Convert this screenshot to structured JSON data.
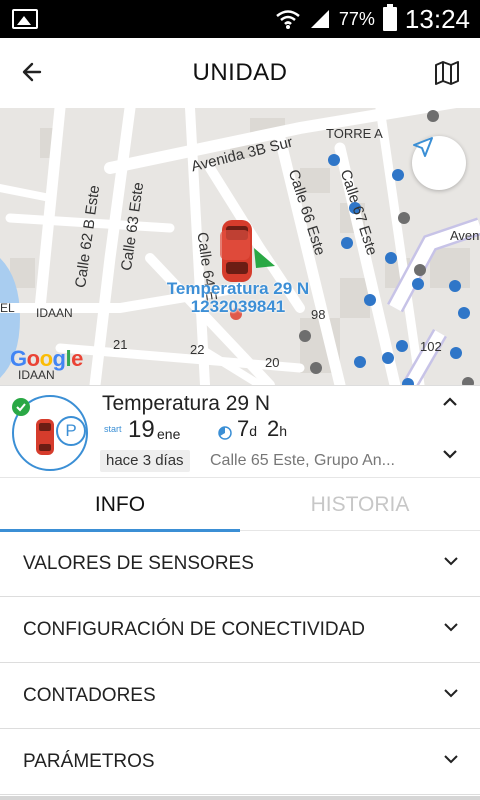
{
  "status_bar": {
    "battery_pct": "77%",
    "time": "13:24",
    "signal_icon": "signal-icon",
    "wifi_icon": "wifi-icon"
  },
  "app_bar": {
    "title": "UNIDAD",
    "back_icon": "arrow-left-icon",
    "map_icon": "map-icon"
  },
  "map": {
    "streets": [
      "Avenida 3B Sur",
      "TORRE A",
      "Calle 62 B Este",
      "Calle 63 Este",
      "Calle 64 E",
      "Calle 66 Este",
      "Calle 67 Este",
      "Aven",
      "IDAAN",
      "IDAAN",
      "EL"
    ],
    "numbers": [
      "21",
      "22",
      "20",
      "98",
      "102"
    ],
    "unit_label_1": "Temperatura 29 N",
    "unit_label_2": "1232039841",
    "google_letters": [
      "G",
      "o",
      "o",
      "g",
      "l",
      "e"
    ]
  },
  "unit": {
    "name": "Temperatura 29 N",
    "start_tag": "start",
    "start_day": "19",
    "start_month": "ene",
    "duration_days": "7",
    "duration_days_unit": "d",
    "duration_hours": "2",
    "duration_hours_unit": "h",
    "ago": "hace 3 días",
    "address": "Calle 65 Este, Grupo An...",
    "parking_badge": "P"
  },
  "tabs": [
    {
      "label": "INFO",
      "active": true
    },
    {
      "label": "HISTORIA",
      "active": false
    }
  ],
  "sections": [
    {
      "label": "VALORES DE SENSORES"
    },
    {
      "label": "CONFIGURACIÓN DE CONECTIVIDAD"
    },
    {
      "label": "CONTADORES"
    },
    {
      "label": "PARÁMETROS"
    }
  ],
  "colors": {
    "accent": "#3b8fd5",
    "label_blue": "#3d8fd6",
    "online_green": "#2aa845",
    "car_red": "#d63c2c"
  }
}
